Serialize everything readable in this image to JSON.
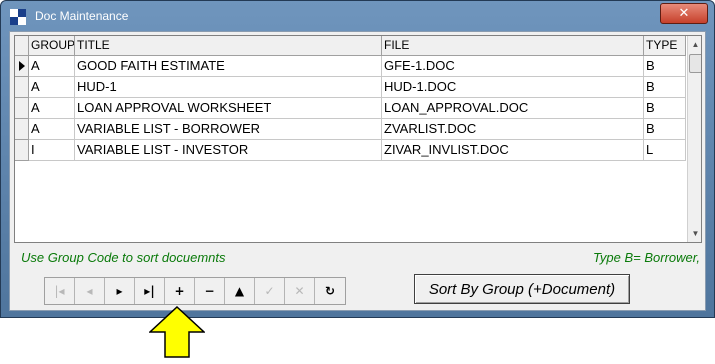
{
  "window": {
    "title": "Doc Maintenance",
    "close_glyph": "✕",
    "icon": "app-icon"
  },
  "grid": {
    "columns": [
      "GROUP",
      "TITLE",
      "FILE",
      "TYPE"
    ],
    "rows": [
      {
        "group": "A",
        "title": "GOOD FAITH ESTIMATE",
        "file": "GFE-1.DOC",
        "type": "B",
        "current": true
      },
      {
        "group": "A",
        "title": "HUD-1",
        "file": "HUD-1.DOC",
        "type": "B"
      },
      {
        "group": "A",
        "title": "LOAN APPROVAL WORKSHEET",
        "file": "LOAN_APPROVAL.DOC",
        "type": "B"
      },
      {
        "group": "A",
        "title": "VARIABLE LIST - BORROWER",
        "file": "ZVARLIST.DOC",
        "type": "B"
      },
      {
        "group": "I",
        "title": "VARIABLE LIST - INVESTOR",
        "file": "ZIVAR_INVLIST.DOC",
        "type": "L"
      }
    ]
  },
  "hints": {
    "left": "Use Group Code to sort docuemnts",
    "right": "Type B= Borrower,"
  },
  "navigator": [
    {
      "name": "first-record-button",
      "glyph": "|◂",
      "enabled": false
    },
    {
      "name": "prior-record-button",
      "glyph": "◂",
      "enabled": false
    },
    {
      "name": "next-record-button",
      "glyph": "▸",
      "enabled": true
    },
    {
      "name": "last-record-button",
      "glyph": "▸|",
      "enabled": true
    },
    {
      "name": "insert-record-button",
      "glyph": "+",
      "enabled": true
    },
    {
      "name": "delete-record-button",
      "glyph": "−",
      "enabled": true
    },
    {
      "name": "edit-record-button",
      "glyph": "▲",
      "enabled": true
    },
    {
      "name": "post-edit-button",
      "glyph": "✓",
      "enabled": false
    },
    {
      "name": "cancel-edit-button",
      "glyph": "✕",
      "enabled": false
    },
    {
      "name": "refresh-button",
      "glyph": "↻",
      "enabled": true
    }
  ],
  "sort_button": {
    "label": "Sort By Group (+Document)"
  },
  "colors": {
    "hint_text": "#0a7a0a",
    "arrow_fill": "#ffff00",
    "title_bar": "#5a80a8"
  }
}
